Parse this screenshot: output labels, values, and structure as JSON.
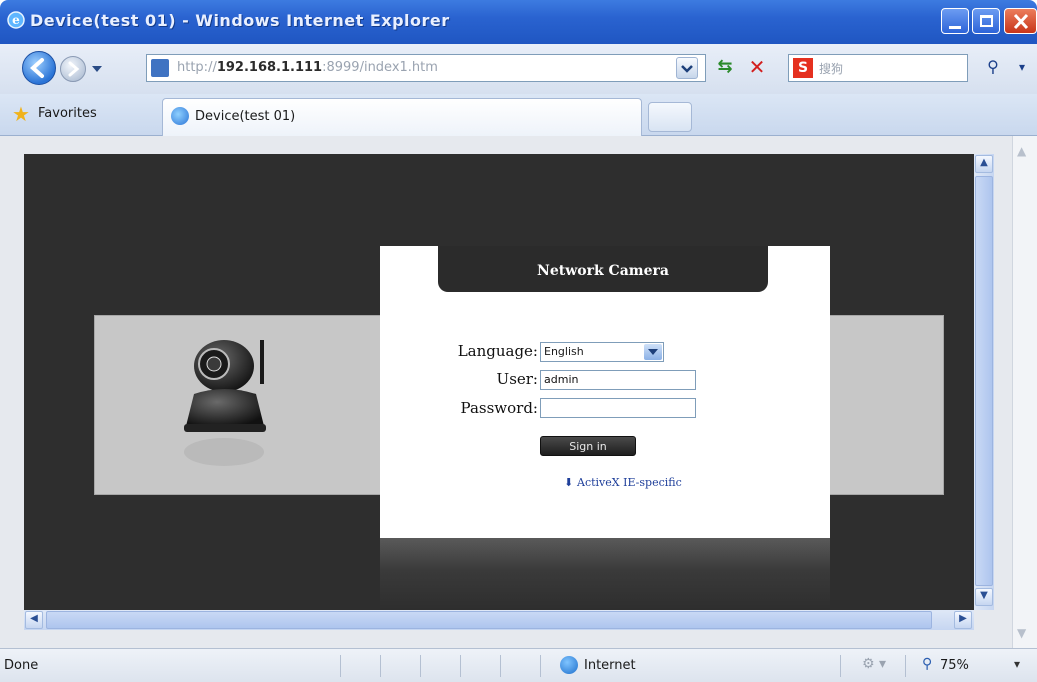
{
  "window": {
    "title": "Device(test 01) - Windows Internet Explorer"
  },
  "addressbar": {
    "url_prefix": "http://",
    "url_host": "192.168.1.111",
    "url_suffix": ":8999/index1.htm",
    "search_placeholder": "搜狗"
  },
  "tabs": {
    "favorites_label": "Favorites",
    "items": [
      {
        "label": "Device(test 01)"
      }
    ]
  },
  "login": {
    "header": "Network Camera",
    "language_label": "Language:",
    "language_value": "English",
    "user_label": "User:",
    "user_value": "admin",
    "password_label": "Password:",
    "password_value": "",
    "signin_label": "Sign in",
    "activex_label": "ActiveX IE-specific"
  },
  "status": {
    "done": "Done",
    "zone": "Internet",
    "zoom": "75%"
  },
  "icons": {
    "title_icon": "ie-icon",
    "back": "back-arrow-icon",
    "forward": "forward-arrow-icon",
    "refresh": "refresh-icon",
    "stop": "stop-icon",
    "search": "search-icon",
    "favorites": "star-icon",
    "download": "download-icon",
    "globe": "globe-icon",
    "zoom": "magnifier-icon"
  },
  "colors": {
    "titlebar": "#2a63d0",
    "viewport_bg": "#2e2e2e",
    "card_header": "#2b2b2b",
    "link": "#1f3f9a"
  }
}
